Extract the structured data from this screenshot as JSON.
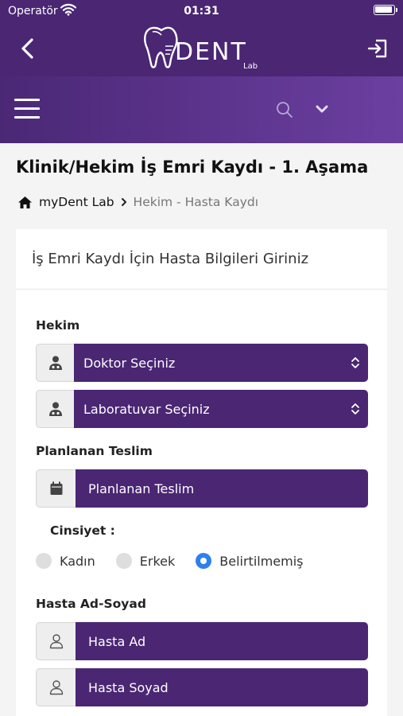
{
  "status_bar": {
    "carrier": "Operatör",
    "time": "01:31"
  },
  "header": {
    "logo_text": "DENT",
    "logo_sub": "Lab"
  },
  "page": {
    "title": "Klinik/Hekim İş Emri Kaydı - 1. Aşama",
    "breadcrumb": {
      "home": "myDent Lab",
      "current": "Hekim - Hasta Kaydı"
    }
  },
  "form": {
    "card_title": "İş Emri Kaydı İçin Hasta Bilgileri Giriniz",
    "hekim_label": "Hekim",
    "doctor_select": "Doktor Seçiniz",
    "lab_select": "Laboratuvar Seçiniz",
    "delivery_label": "Planlanan Teslim",
    "delivery_placeholder": "Planlanan Teslim",
    "gender_label": "Cinsiyet :",
    "gender_options": [
      "Kadın",
      "Erkek",
      "Belirtilmemiş"
    ],
    "gender_selected": "Belirtilmemiş",
    "patient_label": "Hasta Ad-Soyad",
    "first_name_placeholder": "Hasta Ad",
    "last_name_placeholder": "Hasta Soyad"
  },
  "colors": {
    "primary": "#4a2673",
    "radio_selected": "#2f80ed",
    "card": "#ffffff",
    "background": "#f4f4f4"
  }
}
